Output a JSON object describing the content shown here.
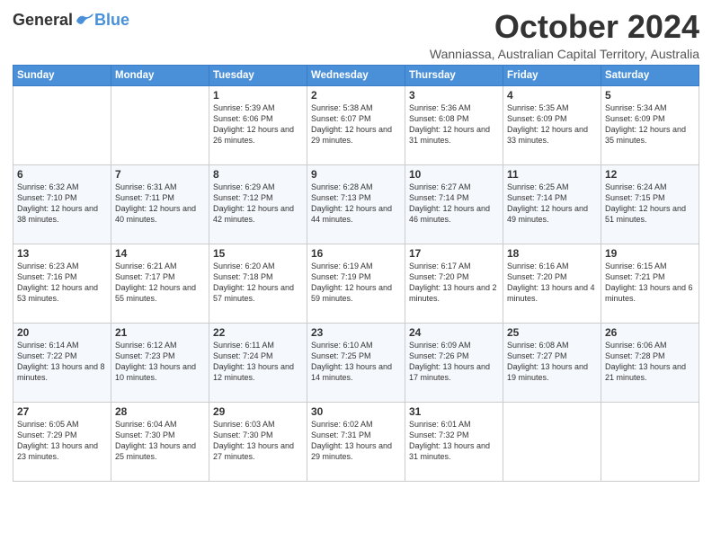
{
  "header": {
    "logo_general": "General",
    "logo_blue": "Blue",
    "title": "October 2024",
    "subtitle": "Wanniassa, Australian Capital Territory, Australia"
  },
  "days_of_week": [
    "Sunday",
    "Monday",
    "Tuesday",
    "Wednesday",
    "Thursday",
    "Friday",
    "Saturday"
  ],
  "weeks": [
    [
      {
        "day": "",
        "info": ""
      },
      {
        "day": "",
        "info": ""
      },
      {
        "day": "1",
        "info": "Sunrise: 5:39 AM\nSunset: 6:06 PM\nDaylight: 12 hours\nand 26 minutes."
      },
      {
        "day": "2",
        "info": "Sunrise: 5:38 AM\nSunset: 6:07 PM\nDaylight: 12 hours\nand 29 minutes."
      },
      {
        "day": "3",
        "info": "Sunrise: 5:36 AM\nSunset: 6:08 PM\nDaylight: 12 hours\nand 31 minutes."
      },
      {
        "day": "4",
        "info": "Sunrise: 5:35 AM\nSunset: 6:09 PM\nDaylight: 12 hours\nand 33 minutes."
      },
      {
        "day": "5",
        "info": "Sunrise: 5:34 AM\nSunset: 6:09 PM\nDaylight: 12 hours\nand 35 minutes."
      }
    ],
    [
      {
        "day": "6",
        "info": "Sunrise: 6:32 AM\nSunset: 7:10 PM\nDaylight: 12 hours\nand 38 minutes."
      },
      {
        "day": "7",
        "info": "Sunrise: 6:31 AM\nSunset: 7:11 PM\nDaylight: 12 hours\nand 40 minutes."
      },
      {
        "day": "8",
        "info": "Sunrise: 6:29 AM\nSunset: 7:12 PM\nDaylight: 12 hours\nand 42 minutes."
      },
      {
        "day": "9",
        "info": "Sunrise: 6:28 AM\nSunset: 7:13 PM\nDaylight: 12 hours\nand 44 minutes."
      },
      {
        "day": "10",
        "info": "Sunrise: 6:27 AM\nSunset: 7:14 PM\nDaylight: 12 hours\nand 46 minutes."
      },
      {
        "day": "11",
        "info": "Sunrise: 6:25 AM\nSunset: 7:14 PM\nDaylight: 12 hours\nand 49 minutes."
      },
      {
        "day": "12",
        "info": "Sunrise: 6:24 AM\nSunset: 7:15 PM\nDaylight: 12 hours\nand 51 minutes."
      }
    ],
    [
      {
        "day": "13",
        "info": "Sunrise: 6:23 AM\nSunset: 7:16 PM\nDaylight: 12 hours\nand 53 minutes."
      },
      {
        "day": "14",
        "info": "Sunrise: 6:21 AM\nSunset: 7:17 PM\nDaylight: 12 hours\nand 55 minutes."
      },
      {
        "day": "15",
        "info": "Sunrise: 6:20 AM\nSunset: 7:18 PM\nDaylight: 12 hours\nand 57 minutes."
      },
      {
        "day": "16",
        "info": "Sunrise: 6:19 AM\nSunset: 7:19 PM\nDaylight: 12 hours\nand 59 minutes."
      },
      {
        "day": "17",
        "info": "Sunrise: 6:17 AM\nSunset: 7:20 PM\nDaylight: 13 hours\nand 2 minutes."
      },
      {
        "day": "18",
        "info": "Sunrise: 6:16 AM\nSunset: 7:20 PM\nDaylight: 13 hours\nand 4 minutes."
      },
      {
        "day": "19",
        "info": "Sunrise: 6:15 AM\nSunset: 7:21 PM\nDaylight: 13 hours\nand 6 minutes."
      }
    ],
    [
      {
        "day": "20",
        "info": "Sunrise: 6:14 AM\nSunset: 7:22 PM\nDaylight: 13 hours\nand 8 minutes."
      },
      {
        "day": "21",
        "info": "Sunrise: 6:12 AM\nSunset: 7:23 PM\nDaylight: 13 hours\nand 10 minutes."
      },
      {
        "day": "22",
        "info": "Sunrise: 6:11 AM\nSunset: 7:24 PM\nDaylight: 13 hours\nand 12 minutes."
      },
      {
        "day": "23",
        "info": "Sunrise: 6:10 AM\nSunset: 7:25 PM\nDaylight: 13 hours\nand 14 minutes."
      },
      {
        "day": "24",
        "info": "Sunrise: 6:09 AM\nSunset: 7:26 PM\nDaylight: 13 hours\nand 17 minutes."
      },
      {
        "day": "25",
        "info": "Sunrise: 6:08 AM\nSunset: 7:27 PM\nDaylight: 13 hours\nand 19 minutes."
      },
      {
        "day": "26",
        "info": "Sunrise: 6:06 AM\nSunset: 7:28 PM\nDaylight: 13 hours\nand 21 minutes."
      }
    ],
    [
      {
        "day": "27",
        "info": "Sunrise: 6:05 AM\nSunset: 7:29 PM\nDaylight: 13 hours\nand 23 minutes."
      },
      {
        "day": "28",
        "info": "Sunrise: 6:04 AM\nSunset: 7:30 PM\nDaylight: 13 hours\nand 25 minutes."
      },
      {
        "day": "29",
        "info": "Sunrise: 6:03 AM\nSunset: 7:30 PM\nDaylight: 13 hours\nand 27 minutes."
      },
      {
        "day": "30",
        "info": "Sunrise: 6:02 AM\nSunset: 7:31 PM\nDaylight: 13 hours\nand 29 minutes."
      },
      {
        "day": "31",
        "info": "Sunrise: 6:01 AM\nSunset: 7:32 PM\nDaylight: 13 hours\nand 31 minutes."
      },
      {
        "day": "",
        "info": ""
      },
      {
        "day": "",
        "info": ""
      }
    ]
  ],
  "colors": {
    "header_bg": "#4a90d9",
    "accent": "#4a90d9"
  }
}
